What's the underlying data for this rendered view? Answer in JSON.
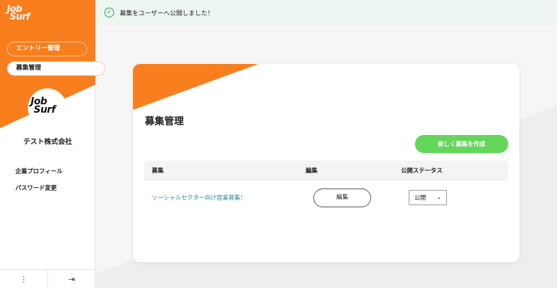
{
  "brand": {
    "logo": "Job Surf"
  },
  "sidebar": {
    "nav": [
      {
        "label": "エントリー管理"
      },
      {
        "label": "募集管理"
      }
    ],
    "company": "テスト株式会社",
    "links": [
      {
        "label": "企業プロフィール"
      },
      {
        "label": "パスワード変更"
      }
    ]
  },
  "banner": {
    "message": "募集をユーザーへ公開しました！"
  },
  "main": {
    "title": "募集管理",
    "new_button": "新しく募集を作成",
    "columns": [
      "募集",
      "編集",
      "公開ステータス"
    ],
    "rows": [
      {
        "title": "ソーシャルセクター向け営業募集！",
        "edit": "編集",
        "status": "公開"
      }
    ]
  },
  "colors": {
    "accent": "#f97f1e",
    "primary_button": "#65d65c",
    "link": "#2a8a9a"
  }
}
